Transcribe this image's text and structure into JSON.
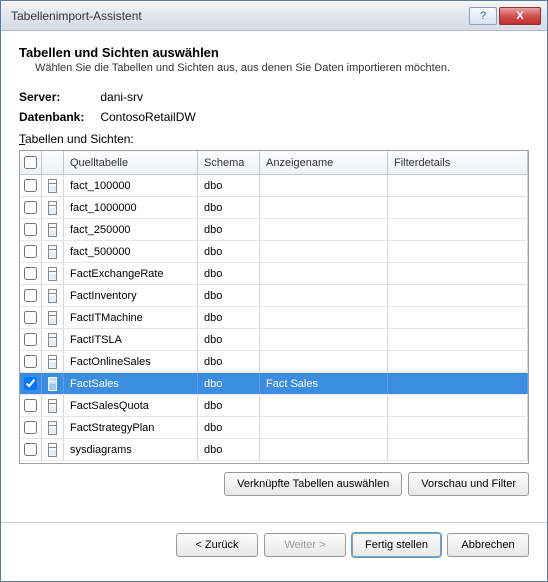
{
  "window": {
    "title": "Tabellenimport-Assistent",
    "help": "?",
    "close": "X"
  },
  "header": {
    "heading": "Tabellen und Sichten auswählen",
    "sub": "Wählen Sie die Tabellen und Sichten aus, aus denen Sie Daten importieren möchten."
  },
  "info": {
    "server_label": "Server:",
    "server_value": "dani-srv",
    "db_label": "Datenbank:",
    "db_value": "ContosoRetailDW",
    "tables_label_pre": "T",
    "tables_label_rest": "abellen und Sichten:"
  },
  "columns": {
    "source": "Quelltabelle",
    "schema": "Schema",
    "friendly": "Anzeigename",
    "filter": "Filterdetails"
  },
  "rows": [
    {
      "checked": false,
      "name": "fact_100000",
      "schema": "dbo",
      "friendly": "",
      "selected": false
    },
    {
      "checked": false,
      "name": "fact_1000000",
      "schema": "dbo",
      "friendly": "",
      "selected": false
    },
    {
      "checked": false,
      "name": "fact_250000",
      "schema": "dbo",
      "friendly": "",
      "selected": false
    },
    {
      "checked": false,
      "name": "fact_500000",
      "schema": "dbo",
      "friendly": "",
      "selected": false
    },
    {
      "checked": false,
      "name": "FactExchangeRate",
      "schema": "dbo",
      "friendly": "",
      "selected": false
    },
    {
      "checked": false,
      "name": "FactInventory",
      "schema": "dbo",
      "friendly": "",
      "selected": false
    },
    {
      "checked": false,
      "name": "FactITMachine",
      "schema": "dbo",
      "friendly": "",
      "selected": false
    },
    {
      "checked": false,
      "name": "FactITSLA",
      "schema": "dbo",
      "friendly": "",
      "selected": false
    },
    {
      "checked": false,
      "name": "FactOnlineSales",
      "schema": "dbo",
      "friendly": "",
      "selected": false
    },
    {
      "checked": true,
      "name": "FactSales",
      "schema": "dbo",
      "friendly": "Fact Sales",
      "selected": true
    },
    {
      "checked": false,
      "name": "FactSalesQuota",
      "schema": "dbo",
      "friendly": "",
      "selected": false
    },
    {
      "checked": false,
      "name": "FactStrategyPlan",
      "schema": "dbo",
      "friendly": "",
      "selected": false
    },
    {
      "checked": false,
      "name": "sysdiagrams",
      "schema": "dbo",
      "friendly": "",
      "selected": false
    }
  ],
  "buttons": {
    "related": "Verknüpfte Tabellen auswählen",
    "preview": "Vorschau und Filter",
    "back": "< Zurück",
    "next": "Weiter >",
    "finish": "Fertig stellen",
    "cancel": "Abbrechen"
  }
}
